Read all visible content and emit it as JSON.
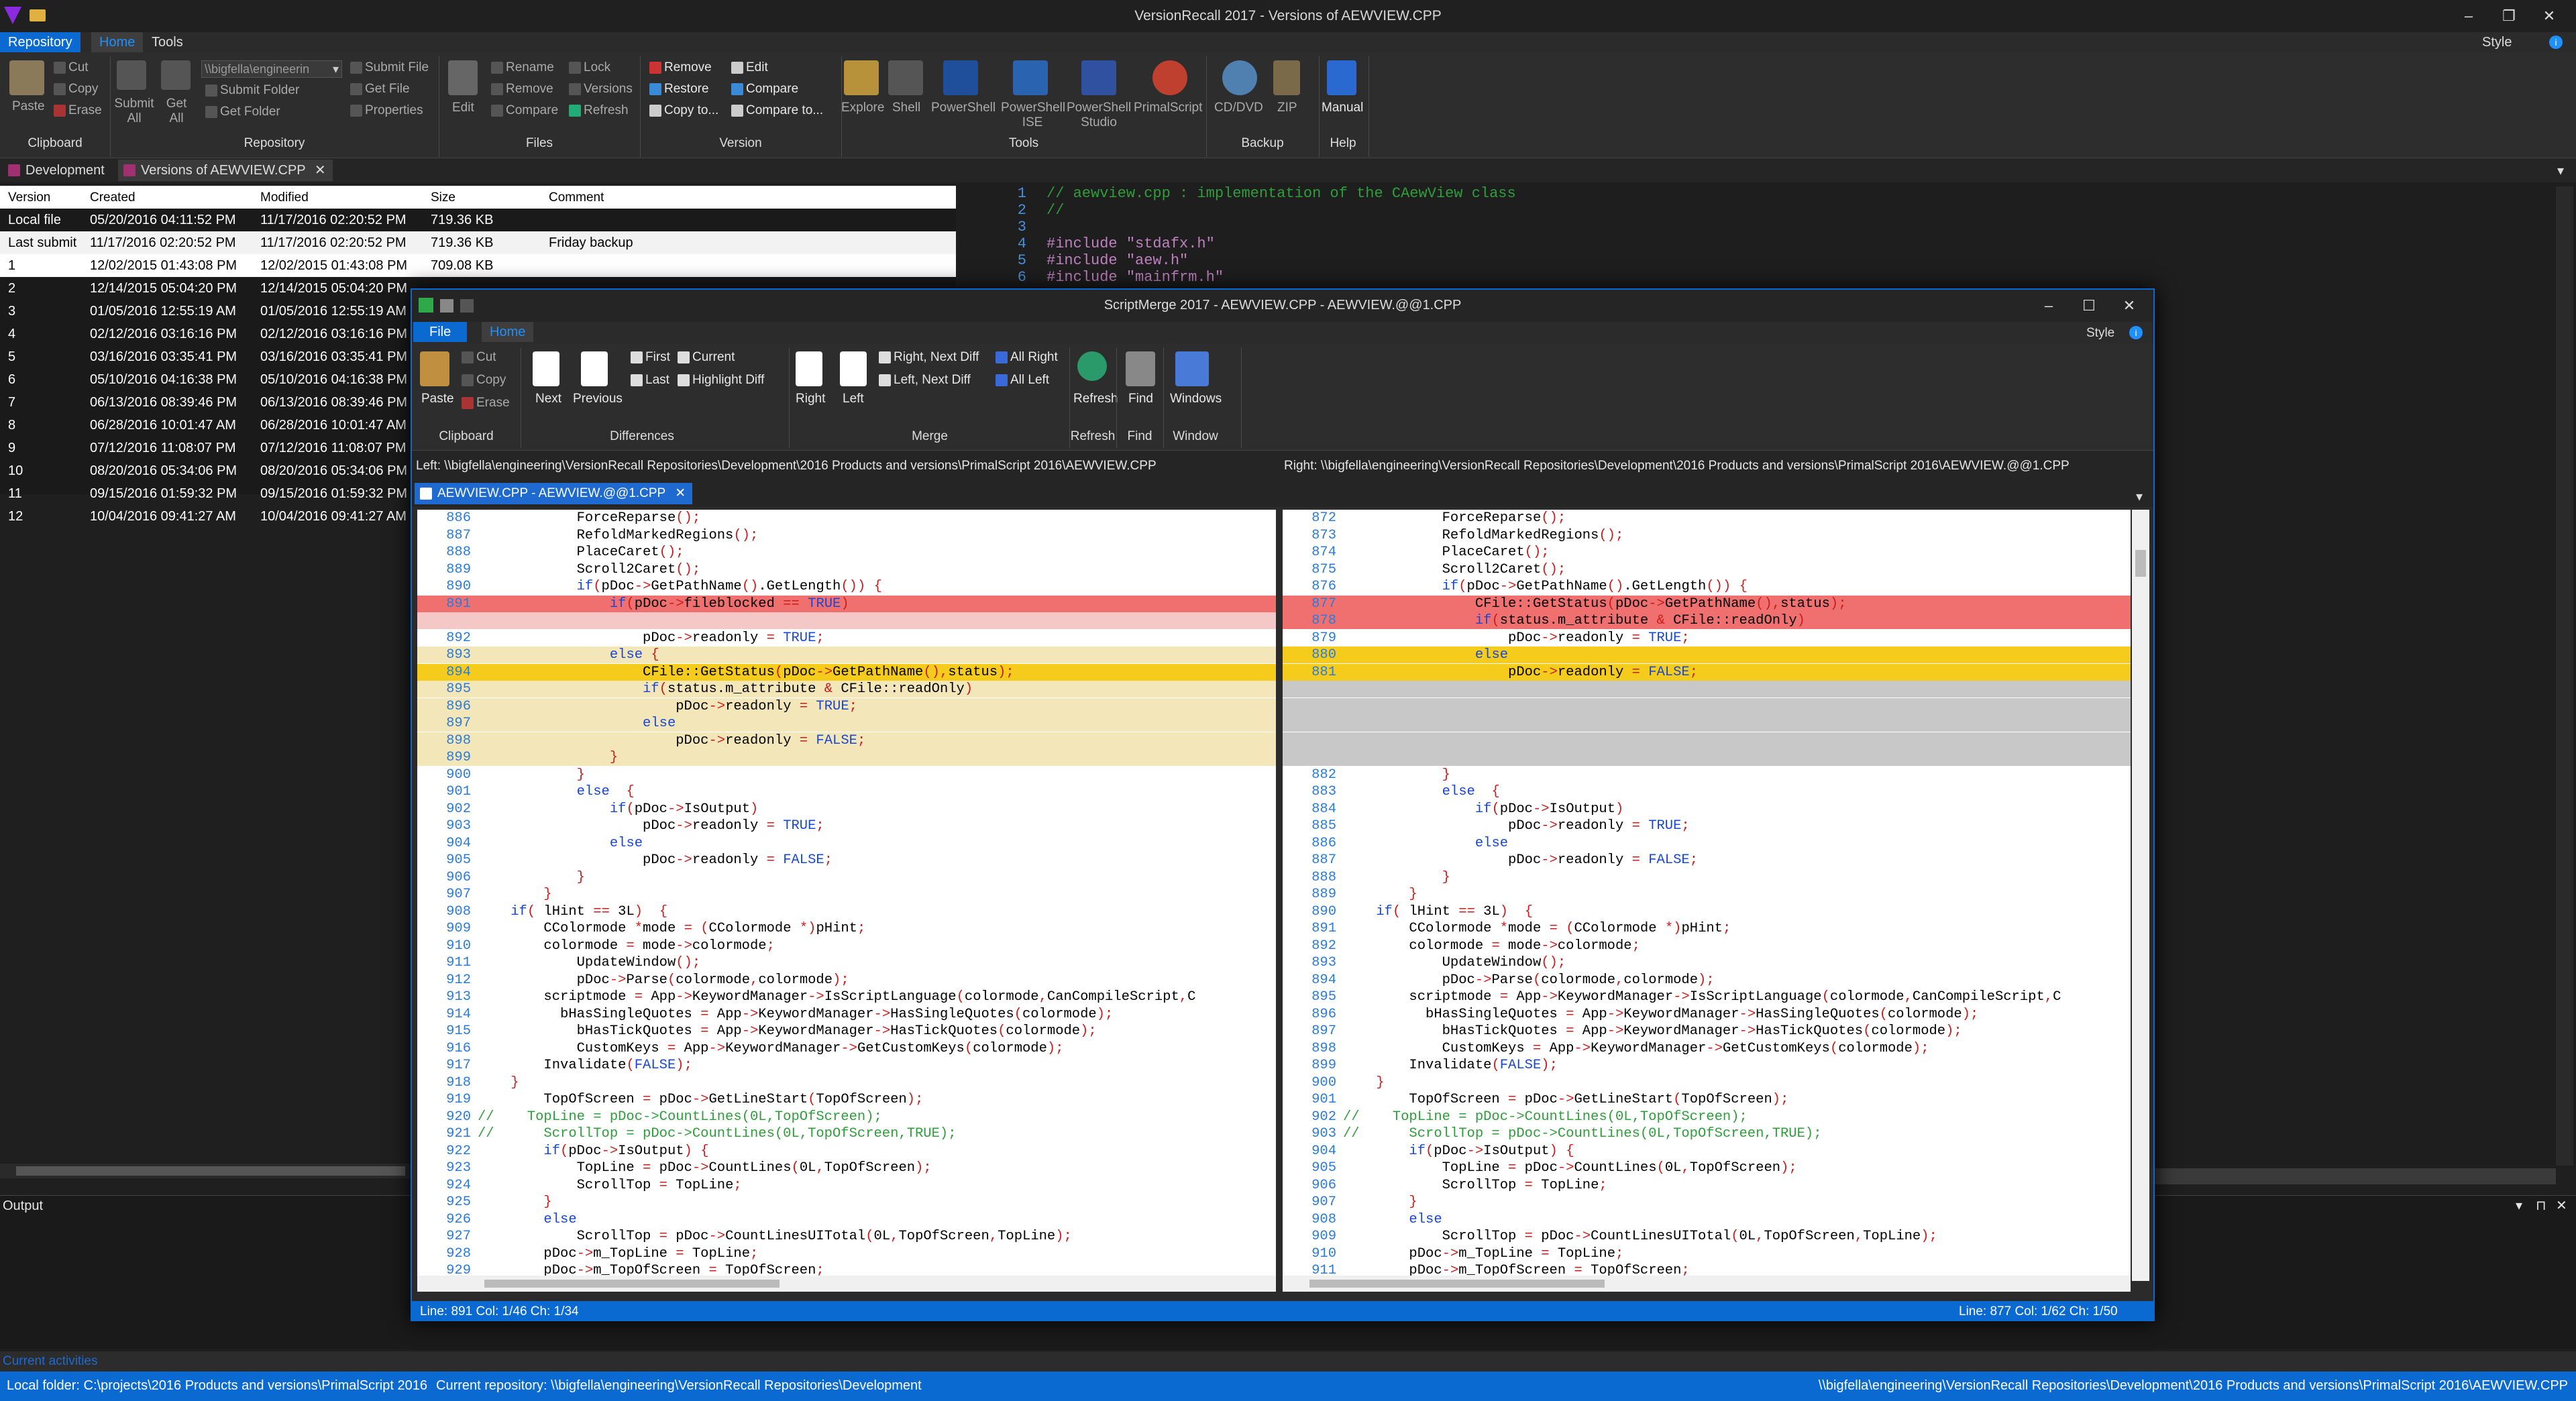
{
  "app": {
    "title": "VersionRecall 2017 - Versions of AEWVIEW.CPP",
    "style_label": "Style"
  },
  "menu": {
    "repository": "Repository",
    "home": "Home",
    "tools": "Tools"
  },
  "ribbon": {
    "clipboard": {
      "paste": "Paste",
      "cut": "Cut",
      "copy": "Copy",
      "erase": "Erase",
      "group": "Clipboard"
    },
    "repository": {
      "submit_all": "Submit\nAll",
      "get_all": "Get\nAll",
      "path": "\\\\bigfella\\engineerin",
      "submit_folder": "Submit Folder",
      "get_folder": "Get Folder",
      "submit_file": "Submit File",
      "get_file": "Get File",
      "properties": "Properties",
      "group": "Repository"
    },
    "files": {
      "edit": "Edit",
      "rename": "Rename",
      "remove": "Remove",
      "compare": "Compare",
      "lock": "Lock",
      "versions": "Versions",
      "refresh": "Refresh",
      "group": "Files"
    },
    "version": {
      "remove": "Remove",
      "restore": "Restore",
      "copy_to": "Copy to...",
      "edit": "Edit",
      "compare": "Compare",
      "compare_to": "Compare to...",
      "group": "Version"
    },
    "tools": {
      "explore": "Explore",
      "shell": "Shell",
      "powershell": "PowerShell",
      "powershell_ise": "PowerShell\nISE",
      "powershell_studio": "PowerShell\nStudio",
      "primalscript": "PrimalScript",
      "group": "Tools"
    },
    "backup": {
      "cddvd": "CD/DVD",
      "zip": "ZIP",
      "group": "Backup"
    },
    "help": {
      "manual": "Manual",
      "group": "Help"
    }
  },
  "doc_tabs": [
    "Development",
    "Versions of AEWVIEW.CPP"
  ],
  "versions": {
    "headers": [
      "Version",
      "Created",
      "Modified",
      "Size",
      "Comment"
    ],
    "rows": [
      [
        "Local file",
        "05/20/2016 04:11:52 PM",
        "11/17/2016 02:20:52 PM",
        "719.36 KB",
        ""
      ],
      [
        "Last submit",
        "11/17/2016 02:20:52 PM",
        "11/17/2016 02:20:52 PM",
        "719.36 KB",
        "Friday backup"
      ],
      [
        "1",
        "12/02/2015 01:43:08 PM",
        "12/02/2015 01:43:08 PM",
        "709.08 KB",
        ""
      ],
      [
        "2",
        "12/14/2015 05:04:20 PM",
        "12/14/2015 05:04:20 PM",
        "",
        ""
      ],
      [
        "3",
        "01/05/2016 12:55:19 AM",
        "01/05/2016 12:55:19 AM",
        "",
        ""
      ],
      [
        "4",
        "02/12/2016 03:16:16 PM",
        "02/12/2016 03:16:16 PM",
        "",
        ""
      ],
      [
        "5",
        "03/16/2016 03:35:41 PM",
        "03/16/2016 03:35:41 PM",
        "",
        ""
      ],
      [
        "6",
        "05/10/2016 04:16:38 PM",
        "05/10/2016 04:16:38 PM",
        "",
        ""
      ],
      [
        "7",
        "06/13/2016 08:39:46 PM",
        "06/13/2016 08:39:46 PM",
        "",
        ""
      ],
      [
        "8",
        "06/28/2016 10:01:47 AM",
        "06/28/2016 10:01:47 AM",
        "",
        ""
      ],
      [
        "9",
        "07/12/2016 11:08:07 PM",
        "07/12/2016 11:08:07 PM",
        "",
        ""
      ],
      [
        "10",
        "08/20/2016 05:34:06 PM",
        "08/20/2016 05:34:06 PM",
        "",
        ""
      ],
      [
        "11",
        "09/15/2016 01:59:32 PM",
        "09/15/2016 01:59:32 PM",
        "",
        ""
      ],
      [
        "12",
        "10/04/2016 09:41:27 AM",
        "10/04/2016 09:41:27 AM",
        "",
        ""
      ]
    ]
  },
  "bg_code": [
    [
      "1",
      "// aewview.cpp : implementation of the CAewView class"
    ],
    [
      "2",
      "//"
    ],
    [
      "3",
      ""
    ],
    [
      "4",
      "#include \"stdafx.h\""
    ],
    [
      "5",
      "#include \"aew.h\""
    ],
    [
      "6",
      "#include \"mainfrm.h\""
    ]
  ],
  "output": {
    "label": "Output"
  },
  "activities": "Current activities",
  "status": {
    "local_folder": "Local folder: C:\\projects\\2016 Products and versions\\PrimalScript 2016",
    "current_repo": "Current repository: \\\\bigfella\\engineering\\VersionRecall Repositories\\Development",
    "right_path": "\\\\bigfella\\engineering\\VersionRecall Repositories\\Development\\2016 Products and versions\\PrimalScript 2016\\AEWVIEW.CPP"
  },
  "scriptmerge": {
    "title": "ScriptMerge 2017 - AEWVIEW.CPP - AEWVIEW.@@1.CPP",
    "menu": {
      "file": "File",
      "home": "Home",
      "style": "Style"
    },
    "ribbon": {
      "paste": "Paste",
      "cut": "Cut",
      "copy": "Copy",
      "erase": "Erase",
      "clipboard": "Clipboard",
      "next": "Next",
      "previous": "Previous",
      "first": "First",
      "last": "Last",
      "current": "Current",
      "highlight_diff": "Highlight Diff",
      "differences": "Differences",
      "right": "Right",
      "left": "Left",
      "right_next_diff": "Right, Next Diff",
      "left_next_diff": "Left, Next Diff",
      "all_right": "All Right",
      "all_left": "All Left",
      "merge": "Merge",
      "refresh": "Refresh",
      "refresh_group": "Refresh",
      "find": "Find",
      "find_group": "Find",
      "windows": "Windows",
      "window_group": "Window"
    },
    "left_path": "Left: \\\\bigfella\\engineering\\VersionRecall Repositories\\Development\\2016 Products and versions\\PrimalScript 2016\\AEWVIEW.CPP",
    "right_path": "Right: \\\\bigfella\\engineering\\VersionRecall Repositories\\Development\\2016 Products and versions\\PrimalScript 2016\\AEWVIEW.@@1.CPP",
    "tab": "AEWVIEW.CPP - AEWVIEW.@@1.CPP",
    "left_status": "Line: 891  Col: 1/46  Ch: 1/34",
    "right_status": "Line: 877  Col: 1/62  Ch: 1/50",
    "left_lines": [
      [
        "886",
        "            ForceReparse();",
        ""
      ],
      [
        "887",
        "            RefoldMarkedRegions();",
        ""
      ],
      [
        "888",
        "            PlaceCaret();",
        ""
      ],
      [
        "889",
        "            Scroll2Caret();",
        ""
      ],
      [
        "890",
        "            if(pDoc->GetPathName().GetLength()) {",
        ""
      ],
      [
        "891",
        "                if(pDoc->fileblocked == TRUE)",
        "red"
      ],
      [
        "",
        "",
        "pink"
      ],
      [
        "892",
        "                    pDoc->readonly = TRUE;",
        ""
      ],
      [
        "893",
        "                else {",
        "lyellow"
      ],
      [
        "894",
        "                    CFile::GetStatus(pDoc->GetPathName(),status);",
        "yellow"
      ],
      [
        "895",
        "                    if(status.m_attribute & CFile::readOnly)",
        "lyellow"
      ],
      [
        "896",
        "                        pDoc->readonly = TRUE;",
        "lyellow"
      ],
      [
        "897",
        "                    else",
        "lyellow"
      ],
      [
        "898",
        "                        pDoc->readonly = FALSE;",
        "lyellow"
      ],
      [
        "899",
        "                }",
        "lyellow"
      ],
      [
        "900",
        "            }",
        ""
      ],
      [
        "901",
        "            else  {",
        ""
      ],
      [
        "902",
        "                if(pDoc->IsOutput)",
        ""
      ],
      [
        "903",
        "                    pDoc->readonly = TRUE;",
        ""
      ],
      [
        "904",
        "                else",
        ""
      ],
      [
        "905",
        "                    pDoc->readonly = FALSE;",
        ""
      ],
      [
        "906",
        "            }",
        ""
      ],
      [
        "907",
        "        }",
        ""
      ],
      [
        "908",
        "    if( lHint == 3L)  {",
        ""
      ],
      [
        "909",
        "        CColormode *mode = (CColormode *)pHint;",
        ""
      ],
      [
        "910",
        "        colormode = mode->colormode;",
        ""
      ],
      [
        "911",
        "            UpdateWindow();",
        ""
      ],
      [
        "912",
        "            pDoc->Parse(colormode,colormode);",
        ""
      ],
      [
        "913",
        "        scriptmode = App->KeywordManager->IsScriptLanguage(colormode,CanCompileScript,C",
        ""
      ],
      [
        "914",
        "          bHasSingleQuotes = App->KeywordManager->HasSingleQuotes(colormode);",
        ""
      ],
      [
        "915",
        "            bHasTickQuotes = App->KeywordManager->HasTickQuotes(colormode);",
        ""
      ],
      [
        "916",
        "            CustomKeys = App->KeywordManager->GetCustomKeys(colormode);",
        ""
      ],
      [
        "917",
        "        Invalidate(FALSE);",
        ""
      ],
      [
        "918",
        "    }",
        ""
      ],
      [
        "919",
        "        TopOfScreen = pDoc->GetLineStart(TopOfScreen);",
        ""
      ],
      [
        "920",
        "//    TopLine = pDoc->CountLines(0L,TopOfScreen);",
        "cm"
      ],
      [
        "921",
        "//      ScrollTop = pDoc->CountLines(0L,TopOfScreen,TRUE);",
        "cm"
      ],
      [
        "922",
        "        if(pDoc->IsOutput) {",
        ""
      ],
      [
        "923",
        "            TopLine = pDoc->CountLines(0L,TopOfScreen);",
        ""
      ],
      [
        "924",
        "            ScrollTop = TopLine;",
        ""
      ],
      [
        "925",
        "        }",
        ""
      ],
      [
        "926",
        "        else",
        ""
      ],
      [
        "927",
        "            ScrollTop = pDoc->CountLinesUITotal(0L,TopOfScreen,TopLine);",
        ""
      ],
      [
        "928",
        "        pDoc->m_TopLine = TopLine;",
        ""
      ],
      [
        "929",
        "        pDoc->m_TopOfScreen = TopOfScreen;",
        ""
      ]
    ],
    "right_lines": [
      [
        "872",
        "            ForceReparse();",
        ""
      ],
      [
        "873",
        "            RefoldMarkedRegions();",
        ""
      ],
      [
        "874",
        "            PlaceCaret();",
        ""
      ],
      [
        "875",
        "            Scroll2Caret();",
        ""
      ],
      [
        "876",
        "            if(pDoc->GetPathName().GetLength()) {",
        ""
      ],
      [
        "877",
        "                CFile::GetStatus(pDoc->GetPathName(),status);",
        "red"
      ],
      [
        "878",
        "                if(status.m_attribute & CFile::readOnly)",
        "red"
      ],
      [
        "879",
        "                    pDoc->readonly = TRUE;",
        ""
      ],
      [
        "880",
        "                else",
        "yellow"
      ],
      [
        "881",
        "                    pDoc->readonly = FALSE;",
        "yellow"
      ],
      [
        "",
        "",
        "gray"
      ],
      [
        "",
        "",
        "gray"
      ],
      [
        "",
        "",
        "gray"
      ],
      [
        "",
        "",
        "gray"
      ],
      [
        "",
        "",
        "gray"
      ],
      [
        "882",
        "            }",
        ""
      ],
      [
        "883",
        "            else  {",
        ""
      ],
      [
        "884",
        "                if(pDoc->IsOutput)",
        ""
      ],
      [
        "885",
        "                    pDoc->readonly = TRUE;",
        ""
      ],
      [
        "886",
        "                else",
        ""
      ],
      [
        "887",
        "                    pDoc->readonly = FALSE;",
        ""
      ],
      [
        "888",
        "            }",
        ""
      ],
      [
        "889",
        "        }",
        ""
      ],
      [
        "890",
        "    if( lHint == 3L)  {",
        ""
      ],
      [
        "891",
        "        CColormode *mode = (CColormode *)pHint;",
        ""
      ],
      [
        "892",
        "        colormode = mode->colormode;",
        ""
      ],
      [
        "893",
        "            UpdateWindow();",
        ""
      ],
      [
        "894",
        "            pDoc->Parse(colormode,colormode);",
        ""
      ],
      [
        "895",
        "        scriptmode = App->KeywordManager->IsScriptLanguage(colormode,CanCompileScript,C",
        ""
      ],
      [
        "896",
        "          bHasSingleQuotes = App->KeywordManager->HasSingleQuotes(colormode);",
        ""
      ],
      [
        "897",
        "            bHasTickQuotes = App->KeywordManager->HasTickQuotes(colormode);",
        ""
      ],
      [
        "898",
        "            CustomKeys = App->KeywordManager->GetCustomKeys(colormode);",
        ""
      ],
      [
        "899",
        "        Invalidate(FALSE);",
        ""
      ],
      [
        "900",
        "    }",
        ""
      ],
      [
        "901",
        "        TopOfScreen = pDoc->GetLineStart(TopOfScreen);",
        ""
      ],
      [
        "902",
        "//    TopLine = pDoc->CountLines(0L,TopOfScreen);",
        "cm"
      ],
      [
        "903",
        "//      ScrollTop = pDoc->CountLines(0L,TopOfScreen,TRUE);",
        "cm"
      ],
      [
        "904",
        "        if(pDoc->IsOutput) {",
        ""
      ],
      [
        "905",
        "            TopLine = pDoc->CountLines(0L,TopOfScreen);",
        ""
      ],
      [
        "906",
        "            ScrollTop = TopLine;",
        ""
      ],
      [
        "907",
        "        }",
        ""
      ],
      [
        "908",
        "        else",
        ""
      ],
      [
        "909",
        "            ScrollTop = pDoc->CountLinesUITotal(0L,TopOfScreen,TopLine);",
        ""
      ],
      [
        "910",
        "        pDoc->m_TopLine = TopLine;",
        ""
      ],
      [
        "911",
        "        pDoc->m_TopOfScreen = TopOfScreen;",
        ""
      ]
    ]
  }
}
